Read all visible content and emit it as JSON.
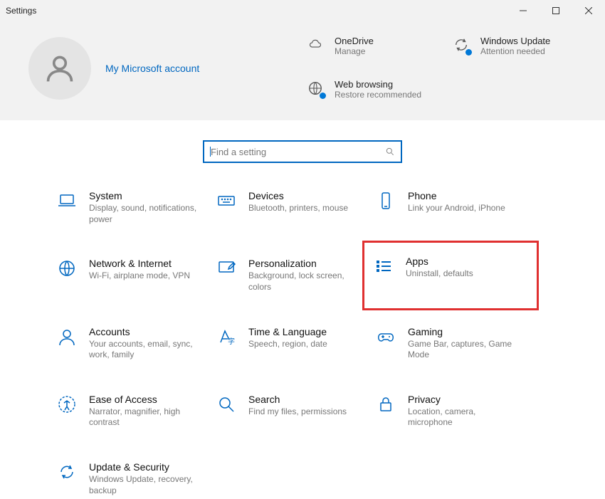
{
  "window": {
    "title": "Settings"
  },
  "account": {
    "link_label": "My Microsoft account"
  },
  "status_tiles": [
    {
      "label": "OneDrive",
      "sub": "Manage",
      "icon": "cloud"
    },
    {
      "label": "Windows Update",
      "sub": "Attention needed",
      "icon": "update-loop"
    },
    {
      "label": "Web browsing",
      "sub": "Restore recommended",
      "icon": "globe"
    }
  ],
  "search": {
    "placeholder": "Find a setting"
  },
  "categories": [
    {
      "label": "System",
      "desc": "Display, sound, notifications, power",
      "icon": "laptop"
    },
    {
      "label": "Devices",
      "desc": "Bluetooth, printers, mouse",
      "icon": "keyboard"
    },
    {
      "label": "Phone",
      "desc": "Link your Android, iPhone",
      "icon": "phone"
    },
    {
      "label": "Network & Internet",
      "desc": "Wi-Fi, airplane mode, VPN",
      "icon": "globe-net"
    },
    {
      "label": "Personalization",
      "desc": "Background, lock screen, colors",
      "icon": "pen"
    },
    {
      "label": "Apps",
      "desc": "Uninstall, defaults",
      "icon": "list",
      "highlighted": true
    },
    {
      "label": "Accounts",
      "desc": "Your accounts, email, sync, work, family",
      "icon": "person"
    },
    {
      "label": "Time & Language",
      "desc": "Speech, region, date",
      "icon": "a-letter"
    },
    {
      "label": "Gaming",
      "desc": "Game Bar, captures, Game Mode",
      "icon": "gamepad"
    },
    {
      "label": "Ease of Access",
      "desc": "Narrator, magnifier, high contrast",
      "icon": "access"
    },
    {
      "label": "Search",
      "desc": "Find my files, permissions",
      "icon": "magnify"
    },
    {
      "label": "Privacy",
      "desc": "Location, camera, microphone",
      "icon": "lock"
    },
    {
      "label": "Update & Security",
      "desc": "Windows Update, recovery, backup",
      "icon": "sync"
    }
  ]
}
